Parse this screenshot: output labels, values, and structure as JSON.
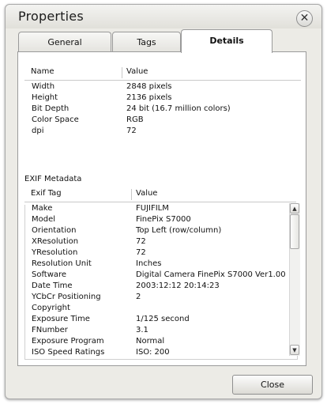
{
  "window": {
    "title": "Properties",
    "close_glyph": "✕"
  },
  "tabs": [
    {
      "label": "General",
      "active": false
    },
    {
      "label": "Tags",
      "active": false
    },
    {
      "label": "Details",
      "active": true
    }
  ],
  "properties": {
    "headers": {
      "name": "Name",
      "value": "Value"
    },
    "rows": [
      {
        "name": "Width",
        "value": "2848 pixels"
      },
      {
        "name": "Height",
        "value": "2136 pixels"
      },
      {
        "name": "Bit Depth",
        "value": "24 bit (16.7 million colors)"
      },
      {
        "name": "Color Space",
        "value": "RGB"
      },
      {
        "name": "dpi",
        "value": "72"
      }
    ]
  },
  "exif": {
    "section_label": "EXIF Metadata",
    "headers": {
      "tag": "Exif Tag",
      "value": "Value"
    },
    "rows": [
      {
        "tag": "Make",
        "value": "FUJIFILM"
      },
      {
        "tag": "Model",
        "value": "FinePix S7000"
      },
      {
        "tag": "Orientation",
        "value": "Top Left (row/column)"
      },
      {
        "tag": "XResolution",
        "value": "72"
      },
      {
        "tag": "YResolution",
        "value": "72"
      },
      {
        "tag": "Resolution Unit",
        "value": "Inches"
      },
      {
        "tag": "Software",
        "value": "Digital Camera FinePix S7000 Ver1.00"
      },
      {
        "tag": "Date Time",
        "value": "2003:12:12 20:14:23"
      },
      {
        "tag": "YCbCr Positioning",
        "value": "2"
      },
      {
        "tag": "Copyright",
        "value": ""
      },
      {
        "tag": "Exposure Time",
        "value": "1/125 second"
      },
      {
        "tag": "FNumber",
        "value": "3.1"
      },
      {
        "tag": "Exposure Program",
        "value": "Normal"
      },
      {
        "tag": "ISO Speed Ratings",
        "value": "ISO: 200"
      }
    ]
  },
  "scrollbar": {
    "up_glyph": "▲",
    "down_glyph": "▼"
  },
  "footer": {
    "close_label": "Close"
  }
}
